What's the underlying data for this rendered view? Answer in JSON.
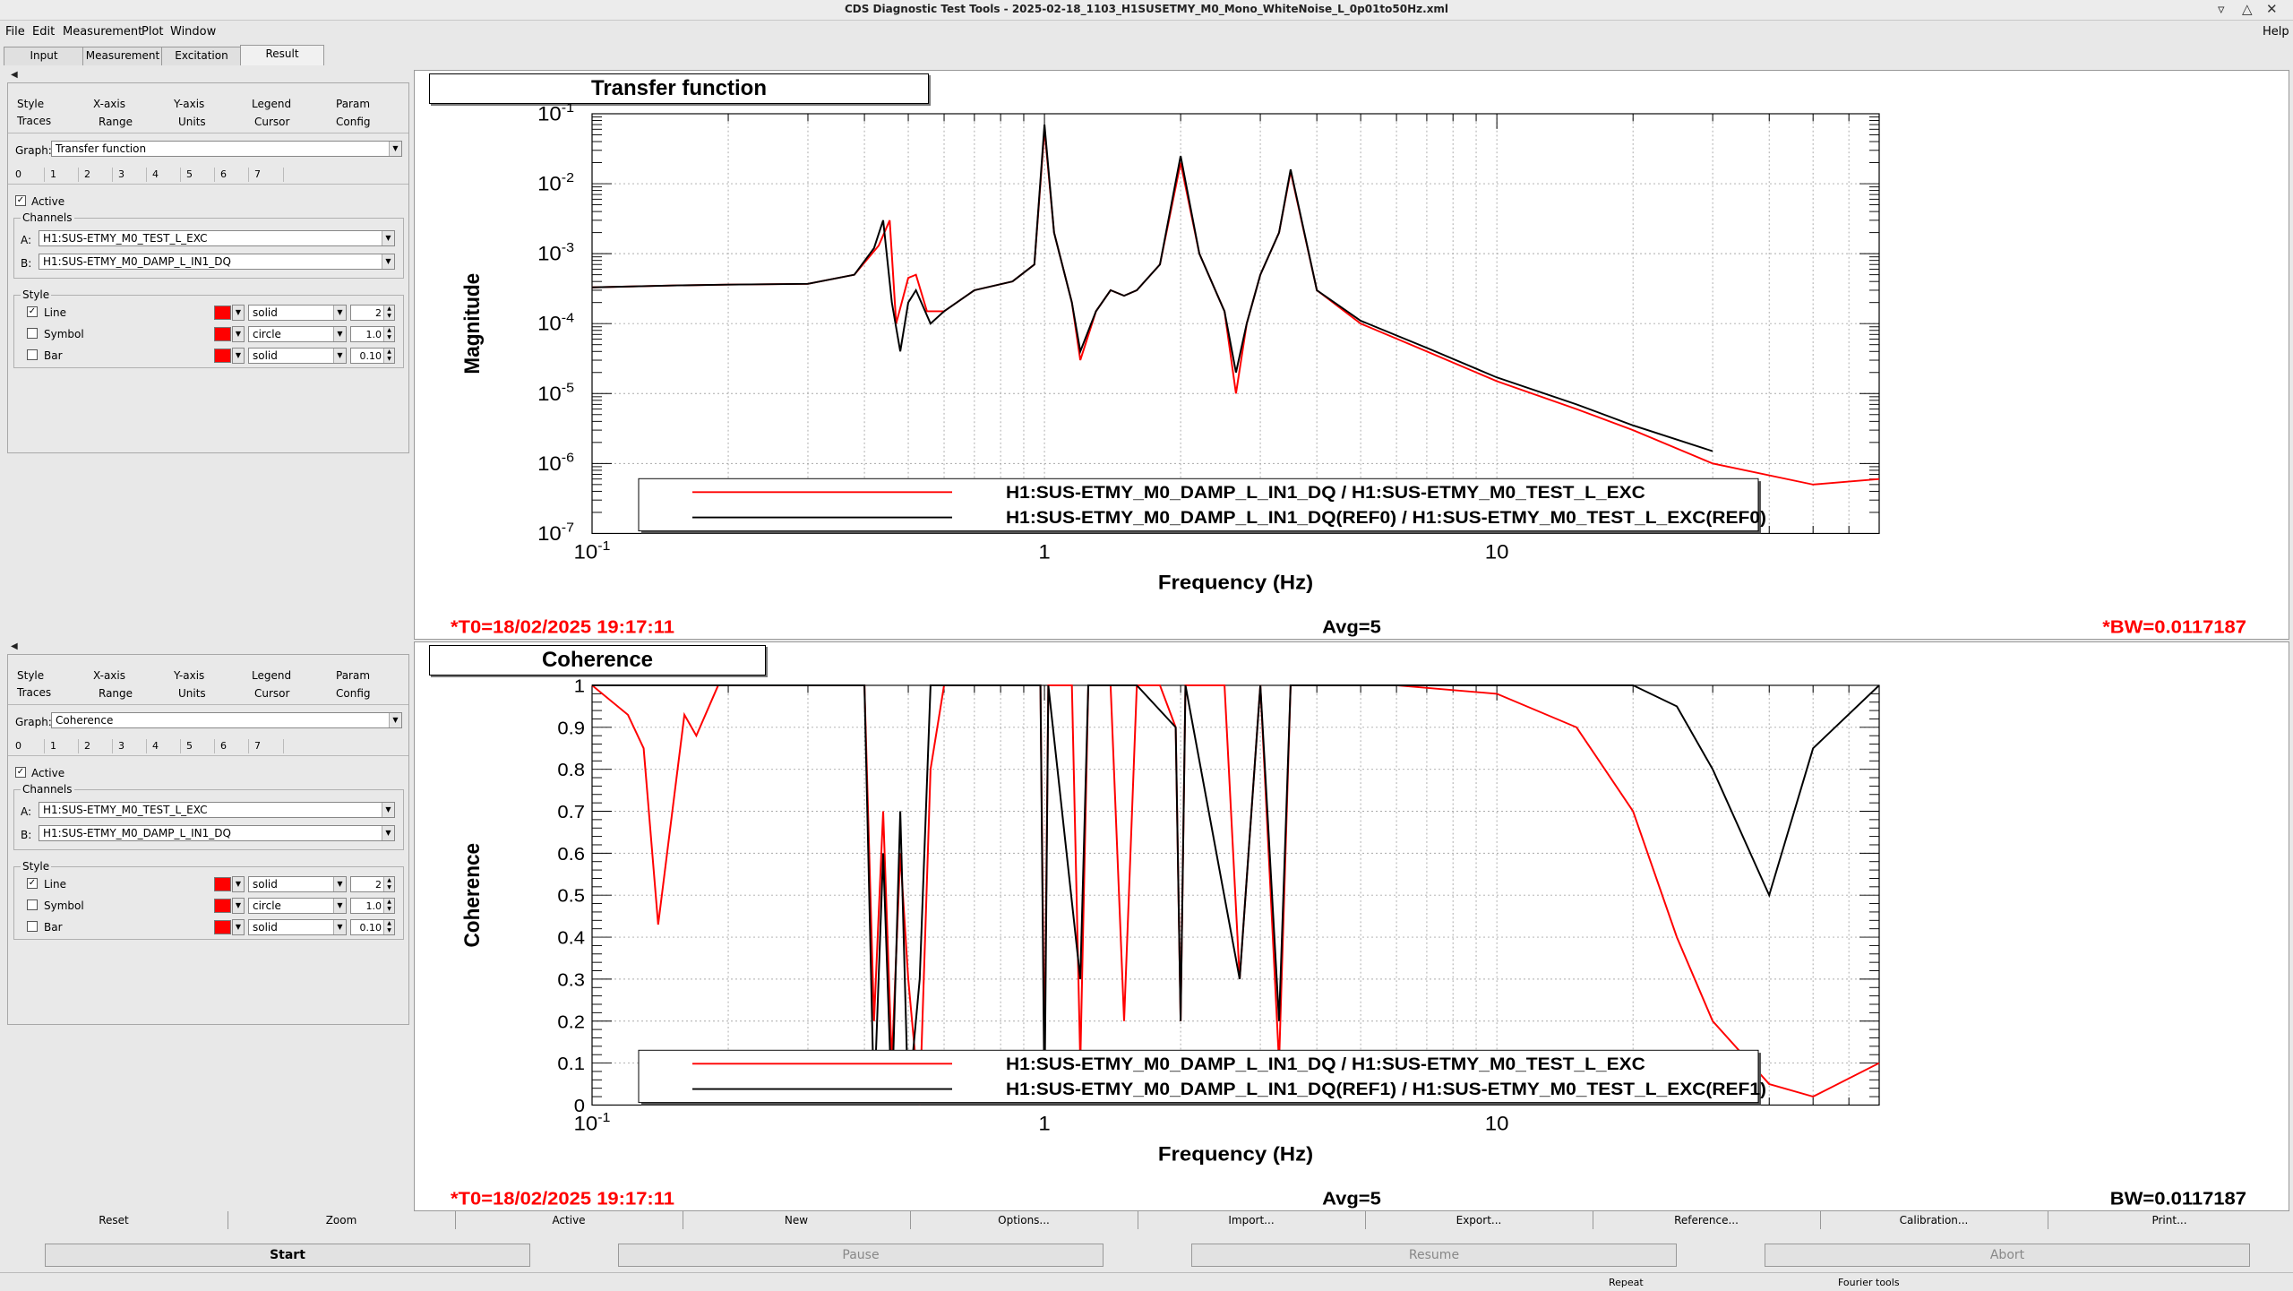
{
  "window": {
    "title": "CDS Diagnostic Test Tools - 2025-02-18_1103_H1SUSETMY_M0_Mono_WhiteNoise_L_0p01to50Hz.xml",
    "help": "Help"
  },
  "menu": [
    "File",
    "Edit",
    "Measurement",
    "Plot",
    "Window"
  ],
  "main_tabs": [
    "Input",
    "Measurement",
    "Excitation",
    "Result"
  ],
  "panels": [
    {
      "subtabs_row1": [
        "Style",
        "X-axis",
        "Y-axis",
        "Legend",
        "Param"
      ],
      "subtabs_row2": [
        "Traces",
        "Range",
        "Units",
        "Cursor",
        "Config"
      ],
      "graph_label": "Graph:",
      "graph_value": "Transfer function",
      "trace_tabs": [
        "0",
        "1",
        "2",
        "3",
        "4",
        "5",
        "6",
        "7"
      ],
      "active_label": "Active",
      "channels_label": "Channels",
      "channel_a_label": "A:",
      "channel_a": "H1:SUS-ETMY_M0_TEST_L_EXC",
      "channel_b_label": "B:",
      "channel_b": "H1:SUS-ETMY_M0_DAMP_L_IN1_DQ",
      "style_label": "Style",
      "line": {
        "label": "Line",
        "type": "solid",
        "value": "2"
      },
      "symbol": {
        "label": "Symbol",
        "type": "circle",
        "value": "1.0"
      },
      "bar": {
        "label": "Bar",
        "type": "solid",
        "value": "0.10"
      }
    },
    {
      "subtabs_row1": [
        "Style",
        "X-axis",
        "Y-axis",
        "Legend",
        "Param"
      ],
      "subtabs_row2": [
        "Traces",
        "Range",
        "Units",
        "Cursor",
        "Config"
      ],
      "graph_label": "Graph:",
      "graph_value": "Coherence",
      "trace_tabs": [
        "0",
        "1",
        "2",
        "3",
        "4",
        "5",
        "6",
        "7"
      ],
      "active_label": "Active",
      "channels_label": "Channels",
      "channel_a_label": "A:",
      "channel_a": "H1:SUS-ETMY_M0_TEST_L_EXC",
      "channel_b_label": "B:",
      "channel_b": "H1:SUS-ETMY_M0_DAMP_L_IN1_DQ",
      "style_label": "Style",
      "line": {
        "label": "Line",
        "type": "solid",
        "value": "2"
      },
      "symbol": {
        "label": "Symbol",
        "type": "circle",
        "value": "1.0"
      },
      "bar": {
        "label": "Bar",
        "type": "solid",
        "value": "0.10"
      }
    }
  ],
  "plots": [
    {
      "title": "Transfer function",
      "t0": "*T0=18/02/2025 19:17:11",
      "avg": "Avg=5",
      "bw": "*BW=0.0117187"
    },
    {
      "title": "Coherence",
      "t0": "*T0=18/02/2025 19:17:11",
      "avg": "Avg=5",
      "bw": "BW=0.0117187"
    }
  ],
  "chart_data": [
    {
      "type": "line",
      "title": "Transfer function",
      "xlabel": "Frequency (Hz)",
      "ylabel": "Magnitude",
      "xscale": "log",
      "yscale": "log",
      "xlim": [
        0.1,
        70
      ],
      "ylim": [
        1e-07,
        0.1
      ],
      "xticks": [
        "10^-1",
        "1",
        "10"
      ],
      "yticks": [
        "10^-7",
        "10^-6",
        "10^-5",
        "10^-4",
        "10^-3",
        "10^-2",
        "10^-1"
      ],
      "grid": true,
      "legend_position": "bottom",
      "series": [
        {
          "name": "H1:SUS-ETMY_M0_DAMP_L_IN1_DQ / H1:SUS-ETMY_M0_TEST_L_EXC",
          "color": "#ff0000",
          "x": [
            0.1,
            0.15,
            0.2,
            0.3,
            0.38,
            0.43,
            0.455,
            0.47,
            0.5,
            0.52,
            0.55,
            0.6,
            0.7,
            0.85,
            0.95,
            1.0,
            1.05,
            1.15,
            1.2,
            1.3,
            1.4,
            1.5,
            1.6,
            1.8,
            2.0,
            2.2,
            2.5,
            2.65,
            2.8,
            3.0,
            3.3,
            3.5,
            4.0,
            5.0,
            7.0,
            10.0,
            15.0,
            20.0,
            30.0,
            50.0,
            70.0
          ],
          "y": [
            0.00033,
            0.00035,
            0.00036,
            0.00037,
            0.0005,
            0.0013,
            0.003,
            0.0001,
            0.00045,
            0.0005,
            0.00015,
            0.00015,
            0.0003,
            0.0004,
            0.0007,
            0.06,
            0.002,
            0.0002,
            3e-05,
            0.00015,
            0.0003,
            0.00025,
            0.0003,
            0.0007,
            0.02,
            0.001,
            0.00015,
            1e-05,
            0.0001,
            0.0005,
            0.002,
            0.015,
            0.0003,
            0.0001,
            4e-05,
            1.5e-05,
            6e-06,
            3e-06,
            1e-06,
            5e-07,
            6e-07
          ]
        },
        {
          "name": "H1:SUS-ETMY_M0_DAMP_L_IN1_DQ(REF0) / H1:SUS-ETMY_M0_TEST_L_EXC(REF0)",
          "color": "#000000",
          "x": [
            0.1,
            0.15,
            0.2,
            0.3,
            0.38,
            0.42,
            0.44,
            0.46,
            0.48,
            0.5,
            0.52,
            0.56,
            0.6,
            0.7,
            0.85,
            0.95,
            1.0,
            1.05,
            1.15,
            1.2,
            1.3,
            1.4,
            1.5,
            1.6,
            1.8,
            2.0,
            2.2,
            2.5,
            2.65,
            2.8,
            3.0,
            3.3,
            3.5,
            4.0,
            5.0,
            7.0,
            10.0,
            15.0,
            20.0,
            30.0
          ],
          "y": [
            0.00033,
            0.00035,
            0.00036,
            0.00037,
            0.0005,
            0.0012,
            0.003,
            0.0002,
            4e-05,
            0.0002,
            0.0003,
            0.0001,
            0.00015,
            0.0003,
            0.0004,
            0.0007,
            0.07,
            0.002,
            0.0002,
            4e-05,
            0.00015,
            0.0003,
            0.00025,
            0.0003,
            0.0007,
            0.025,
            0.001,
            0.00015,
            2e-05,
            0.0001,
            0.0005,
            0.002,
            0.016,
            0.0003,
            0.00011,
            4.5e-05,
            1.7e-05,
            7e-06,
            3.5e-06,
            1.5e-06
          ]
        }
      ]
    },
    {
      "type": "line",
      "title": "Coherence",
      "xlabel": "Frequency (Hz)",
      "ylabel": "Coherence",
      "xscale": "log",
      "yscale": "linear",
      "xlim": [
        0.1,
        70
      ],
      "ylim": [
        0,
        1
      ],
      "xticks": [
        "10^-1",
        "1",
        "10"
      ],
      "yticks": [
        "0",
        "0.1",
        "0.2",
        "0.3",
        "0.4",
        "0.5",
        "0.6",
        "0.7",
        "0.8",
        "0.9",
        "1"
      ],
      "grid": true,
      "legend_position": "bottom",
      "series": [
        {
          "name": "H1:SUS-ETMY_M0_DAMP_L_IN1_DQ / H1:SUS-ETMY_M0_TEST_L_EXC",
          "color": "#ff0000",
          "x": [
            0.1,
            0.12,
            0.13,
            0.14,
            0.16,
            0.17,
            0.19,
            0.22,
            0.3,
            0.4,
            0.42,
            0.44,
            0.46,
            0.48,
            0.5,
            0.53,
            0.56,
            0.6,
            0.8,
            0.98,
            1.0,
            1.02,
            1.15,
            1.2,
            1.25,
            1.4,
            1.5,
            1.6,
            1.8,
            1.95,
            2.0,
            2.05,
            2.5,
            2.7,
            3.0,
            3.3,
            3.5,
            4.0,
            6.0,
            10.0,
            15.0,
            20.0,
            25.0,
            30.0,
            40.0,
            50.0,
            70.0
          ],
          "y": [
            1.0,
            0.93,
            0.85,
            0.43,
            0.93,
            0.88,
            1.0,
            1.0,
            1.0,
            1.0,
            0.2,
            0.7,
            0.1,
            0.6,
            0.3,
            0.0,
            0.8,
            1.0,
            1.0,
            1.0,
            0.1,
            1.0,
            1.0,
            0.1,
            1.0,
            1.0,
            0.2,
            1.0,
            1.0,
            0.9,
            0.2,
            1.0,
            1.0,
            0.3,
            1.0,
            0.1,
            1.0,
            1.0,
            1.0,
            0.98,
            0.9,
            0.7,
            0.4,
            0.2,
            0.05,
            0.02,
            0.1
          ]
        },
        {
          "name": "H1:SUS-ETMY_M0_DAMP_L_IN1_DQ(REF1) / H1:SUS-ETMY_M0_TEST_L_EXC(REF1)",
          "color": "#000000",
          "x": [
            0.1,
            0.2,
            0.3,
            0.4,
            0.42,
            0.44,
            0.46,
            0.48,
            0.5,
            0.53,
            0.56,
            0.6,
            0.8,
            0.98,
            1.0,
            1.02,
            1.2,
            1.25,
            1.4,
            1.6,
            1.95,
            2.0,
            2.05,
            2.7,
            3.0,
            3.3,
            3.5,
            4.0,
            10.0,
            20.0,
            25.0,
            30.0,
            40.0,
            50.0,
            70.0
          ],
          "y": [
            1.0,
            1.0,
            1.0,
            1.0,
            0.0,
            0.6,
            0.0,
            0.7,
            0.0,
            0.3,
            1.0,
            1.0,
            1.0,
            1.0,
            0.0,
            1.0,
            0.3,
            1.0,
            1.0,
            1.0,
            0.9,
            0.2,
            1.0,
            0.3,
            1.0,
            0.2,
            1.0,
            1.0,
            1.0,
            1.0,
            0.95,
            0.8,
            0.5,
            0.85,
            1.0
          ]
        }
      ]
    }
  ],
  "bottom_buttons": [
    "Reset",
    "Zoom",
    "Active",
    "New",
    "Options...",
    "Import...",
    "Export...",
    "Reference...",
    "Calibration...",
    "Print..."
  ],
  "run_buttons": [
    "Start",
    "Pause",
    "Resume",
    "Abort"
  ],
  "status": {
    "repeat": "Repeat",
    "fourier": "Fourier tools"
  }
}
